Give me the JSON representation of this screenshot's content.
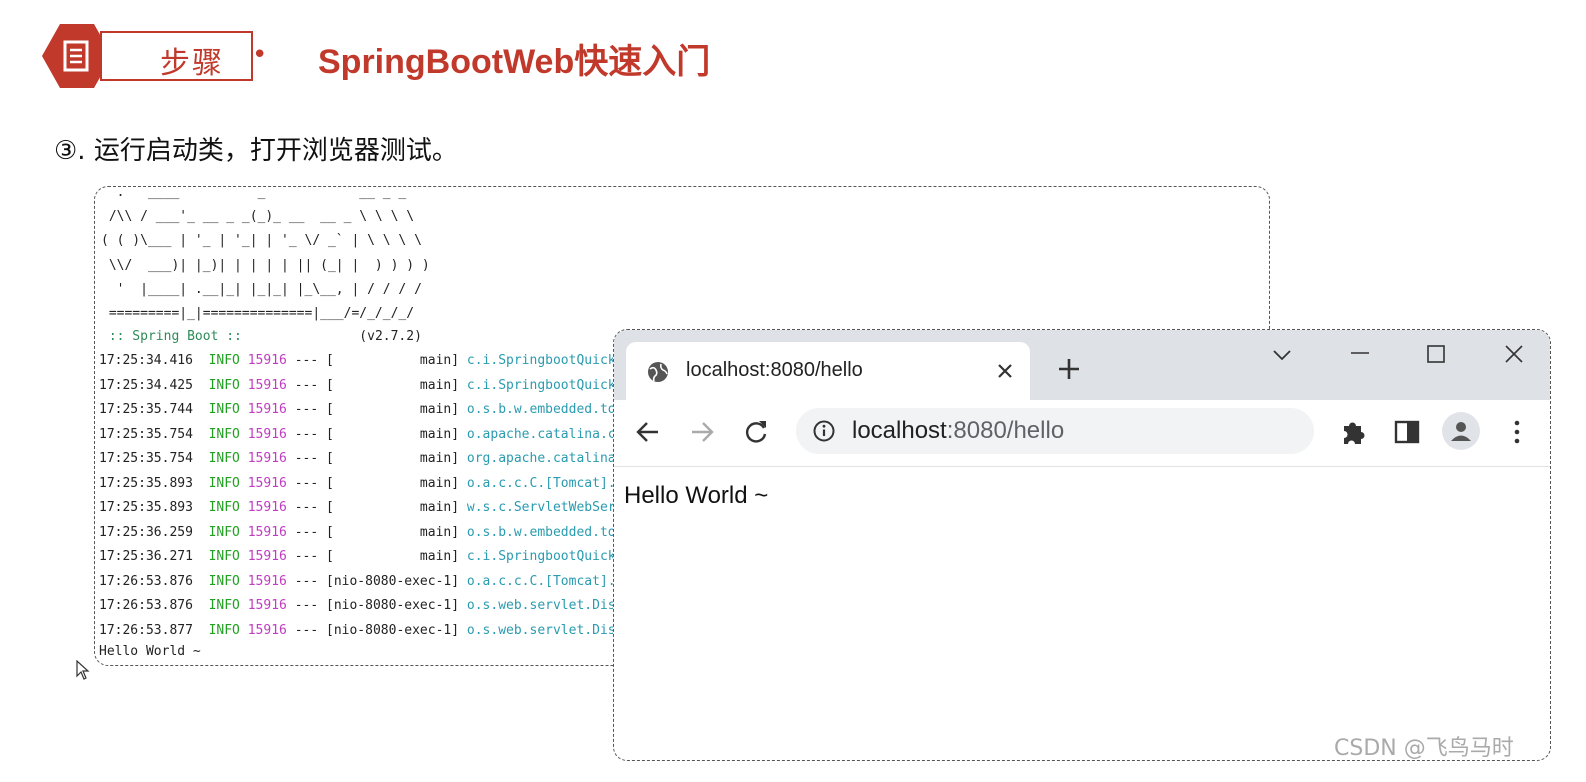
{
  "header": {
    "badge_label": "步骤",
    "bullet": "•",
    "title": "SpringBootWeb快速入门"
  },
  "step": "③. 运行启动类，打开浏览器测试。",
  "console": {
    "ascii_art": "  .   ____          _            __ _ _\n /\\\\ / ___'_ __ _ _(_)_ __  __ _ \\ \\ \\ \\\n( ( )\\___ | '_ | '_| | '_ \\/ _` | \\ \\ \\ \\\n \\\\/  ___)| |_)| | | | | || (_| |  ) ) ) )\n  '  |____| .__|_| |_|_| |_\\__, | / / / /\n =========|_|==============|___/=/_/_/_/",
    "spring_boot_label": " :: Spring Boot :: ",
    "version": "              (v2.7.2)",
    "logs": [
      {
        "time": "17:25:34.416",
        "level": "INFO",
        "pid": "15916",
        "sep": "---",
        "thread": "[           main]",
        "cls": "c.i.SpringbootQuickstartApplication"
      },
      {
        "time": "17:25:34.425",
        "level": "INFO",
        "pid": "15916",
        "sep": "---",
        "thread": "[           main]",
        "cls": "c.i.SpringbootQuickstartApplication"
      },
      {
        "time": "17:25:35.744",
        "level": "INFO",
        "pid": "15916",
        "sep": "---",
        "thread": "[           main]",
        "cls": "o.s.b.w.embedded.tomcat.TomcatWebServer"
      },
      {
        "time": "17:25:35.754",
        "level": "INFO",
        "pid": "15916",
        "sep": "---",
        "thread": "[           main]",
        "cls": "o.apache.catalina.core.StandardService"
      },
      {
        "time": "17:25:35.754",
        "level": "INFO",
        "pid": "15916",
        "sep": "---",
        "thread": "[           main]",
        "cls": "org.apache.catalina.core.StandardEngine"
      },
      {
        "time": "17:25:35.893",
        "level": "INFO",
        "pid": "15916",
        "sep": "---",
        "thread": "[           main]",
        "cls": "o.a.c.c.C.[Tomcat].[localhost].[/]"
      },
      {
        "time": "17:25:35.893",
        "level": "INFO",
        "pid": "15916",
        "sep": "---",
        "thread": "[           main]",
        "cls": "w.s.c.ServletWebServerApplicationContext"
      },
      {
        "time": "17:25:36.259",
        "level": "INFO",
        "pid": "15916",
        "sep": "---",
        "thread": "[           main]",
        "cls": "o.s.b.w.embedded.tomcat.TomcatWebServer"
      },
      {
        "time": "17:25:36.271",
        "level": "INFO",
        "pid": "15916",
        "sep": "---",
        "thread": "[           main]",
        "cls": "c.i.SpringbootQuickstartApplication"
      },
      {
        "time": "17:26:53.876",
        "level": "INFO",
        "pid": "15916",
        "sep": "---",
        "thread": "[nio-8080-exec-1]",
        "cls": "o.a.c.c.C.[Tomcat].[localhost].[/]"
      },
      {
        "time": "17:26:53.876",
        "level": "INFO",
        "pid": "15916",
        "sep": "---",
        "thread": "[nio-8080-exec-1]",
        "cls": "o.s.web.servlet.DispatcherServlet"
      },
      {
        "time": "17:26:53.877",
        "level": "INFO",
        "pid": "15916",
        "sep": "---",
        "thread": "[nio-8080-exec-1]",
        "cls": "o.s.web.servlet.DispatcherServlet"
      }
    ],
    "output": "Hello World ~"
  },
  "browser": {
    "tab_title": "localhost:8080/hello",
    "tab_icon": "globe-icon",
    "url_host": "localhost",
    "url_rest": ":8080/hello",
    "page_text": "Hello World ~"
  },
  "watermark": "CSDN @飞鸟马时",
  "colors": {
    "accent": "#c0392b",
    "log_level": "#22a022",
    "log_pid": "#c03cc0",
    "log_class": "#2a9bb0",
    "tabstrip": "#dee1e6"
  }
}
